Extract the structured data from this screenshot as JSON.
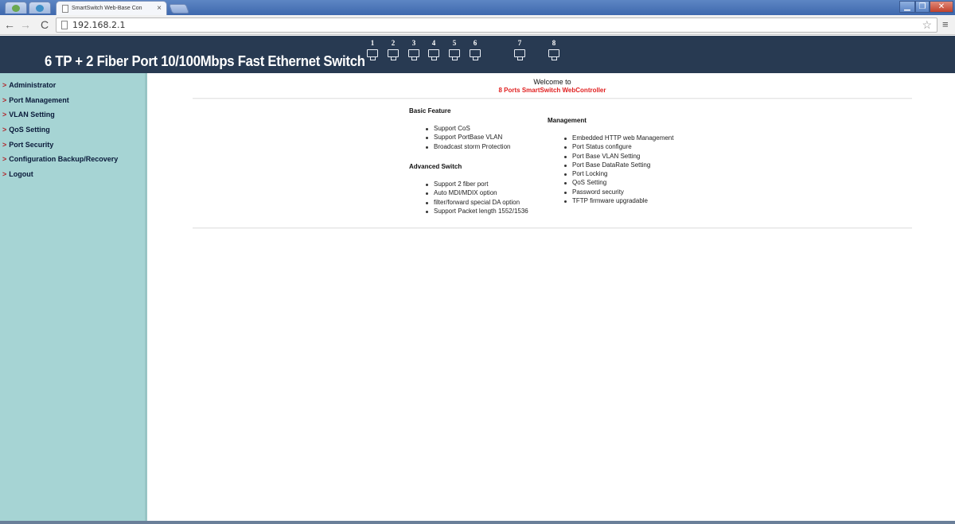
{
  "browser": {
    "tab_title": "SmartSwitch Web-Base Con",
    "tab_close": "×",
    "url": "192.168.2.1"
  },
  "banner": {
    "title": "6 TP + 2 Fiber Port 10/100Mbps Fast Ethernet  Switch",
    "ports": [
      "1",
      "2",
      "3",
      "4",
      "5",
      "6"
    ],
    "fiber_ports": [
      "7",
      "8"
    ]
  },
  "sidebar": {
    "items": [
      {
        "label": "Administrator"
      },
      {
        "label": "Port Management"
      },
      {
        "label": "VLAN Setting"
      },
      {
        "label": "QoS Setting"
      },
      {
        "label": "Port Security"
      },
      {
        "label": "Configuration Backup/Recovery"
      },
      {
        "label": "Logout"
      }
    ]
  },
  "main": {
    "welcome": "Welcome to",
    "welcome_sub": "8 Ports SmartSwitch WebController",
    "basic_feature": {
      "heading": "Basic Feature",
      "items": [
        "Support CoS",
        "Support PortBase VLAN",
        "Broadcast storm Protection"
      ]
    },
    "advanced_switch": {
      "heading": "Advanced Switch",
      "items": [
        "Support 2 fiber port",
        "Auto MDI/MDIX option",
        "filter/forward special DA option",
        "Support Packet length 1552/1536"
      ]
    },
    "management": {
      "heading": "Management",
      "items": [
        "Embedded HTTP web Management",
        "Port Status configure",
        "Port Base VLAN Setting",
        "Port Base DataRate Setting",
        "Port Locking",
        "QoS Setting",
        "Password security",
        "TFTP firmware upgradable"
      ]
    }
  }
}
